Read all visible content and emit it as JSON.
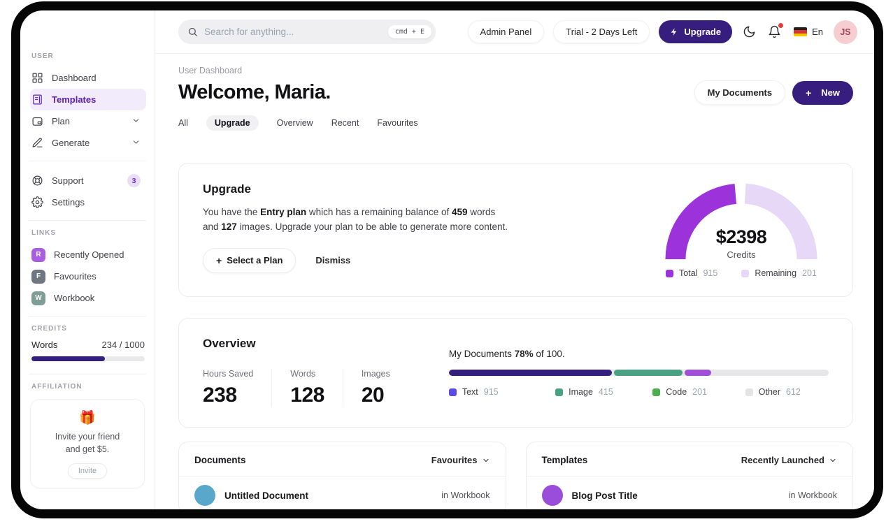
{
  "topbar": {
    "search_placeholder": "Search for anything...",
    "search_shortcut": "cmd + E",
    "admin_panel_label": "Admin Panel",
    "trial_label": "Trial - 2 Days Left",
    "upgrade_label": "Upgrade",
    "language_label": "En",
    "avatar_initials": "JS"
  },
  "sidebar": {
    "user_section_label": "USER",
    "nav_items": [
      {
        "label": "Dashboard"
      },
      {
        "label": "Templates"
      },
      {
        "label": "Plan"
      },
      {
        "label": "Generate"
      }
    ],
    "support_label": "Support",
    "support_badge": "3",
    "settings_label": "Settings",
    "links_section_label": "LINKS",
    "links": [
      {
        "initial": "R",
        "label": "Recently Opened",
        "color": "#a95ee2"
      },
      {
        "initial": "F",
        "label": "Favourites",
        "color": "#6e7681"
      },
      {
        "initial": "W",
        "label": "Workbook",
        "color": "#7d9d95"
      }
    ],
    "credits_section_label": "CREDITS",
    "credits": {
      "label": "Words",
      "value": "234 / 1000",
      "percent": 65,
      "bar_color": "#33207d"
    },
    "affiliation_section_label": "AFFILIATION",
    "affiliation": {
      "icon": "🎁",
      "line1": "Invite your friend",
      "line2": "and get $5.",
      "button_label": "Invite"
    }
  },
  "header": {
    "breadcrumb": "User Dashboard",
    "title": "Welcome, Maria.",
    "tabs": [
      "All",
      "Upgrade",
      "Overview",
      "Recent",
      "Favourites"
    ],
    "my_documents_label": "My Documents",
    "new_label": "New"
  },
  "upgrade_card": {
    "title": "Upgrade",
    "body": {
      "t1": "You have the ",
      "b1": "Entry plan",
      "t2": " which has a remaining balance of ",
      "b2": "459",
      "t3": " words and ",
      "b3": "127",
      "t4": " images. Upgrade your plan to be able to generate more content."
    },
    "select_plan_label": "Select a Plan",
    "dismiss_label": "Dismiss",
    "gauge": {
      "value": "$2398",
      "caption": "Credits",
      "total_color": "#9c33da",
      "remaining_color": "#e8d8f7",
      "legend": [
        {
          "label": "Total",
          "value": "915",
          "color": "#9c33da"
        },
        {
          "label": "Remaining",
          "value": "201",
          "color": "#e8d8f7"
        }
      ]
    }
  },
  "overview_card": {
    "title": "Overview",
    "stats": [
      {
        "label": "Hours Saved",
        "value": "238"
      },
      {
        "label": "Words",
        "value": "128"
      },
      {
        "label": "Images",
        "value": "20"
      }
    ],
    "progress_text": {
      "prefix": "My Documents ",
      "bold": "78%",
      "suffix": " of 100."
    },
    "segments": [
      {
        "color": "#33207d",
        "percent": 43
      },
      {
        "color": "#48a183",
        "percent": 18
      },
      {
        "color": "#a14ed9",
        "percent": 7
      }
    ],
    "legend": [
      {
        "label": "Text",
        "value": "915",
        "color": "#5b4be0"
      },
      {
        "label": "Image",
        "value": "415",
        "color": "#48a183"
      },
      {
        "label": "Code",
        "value": "201",
        "color": "#4ab04e"
      },
      {
        "label": "Other",
        "value": "612",
        "color": "#e3e3e6"
      }
    ]
  },
  "documents_card": {
    "title": "Documents",
    "filter_label": "Favourites",
    "rows": [
      {
        "title": "Untitled Document",
        "location": "in Workbook",
        "avatar_color": "#5aa7cc"
      }
    ]
  },
  "templates_card": {
    "title": "Templates",
    "filter_label": "Recently Launched",
    "rows": [
      {
        "title": "Blog Post Title",
        "location": "in Workbook",
        "avatar_color": "#9a4ddb"
      }
    ]
  }
}
